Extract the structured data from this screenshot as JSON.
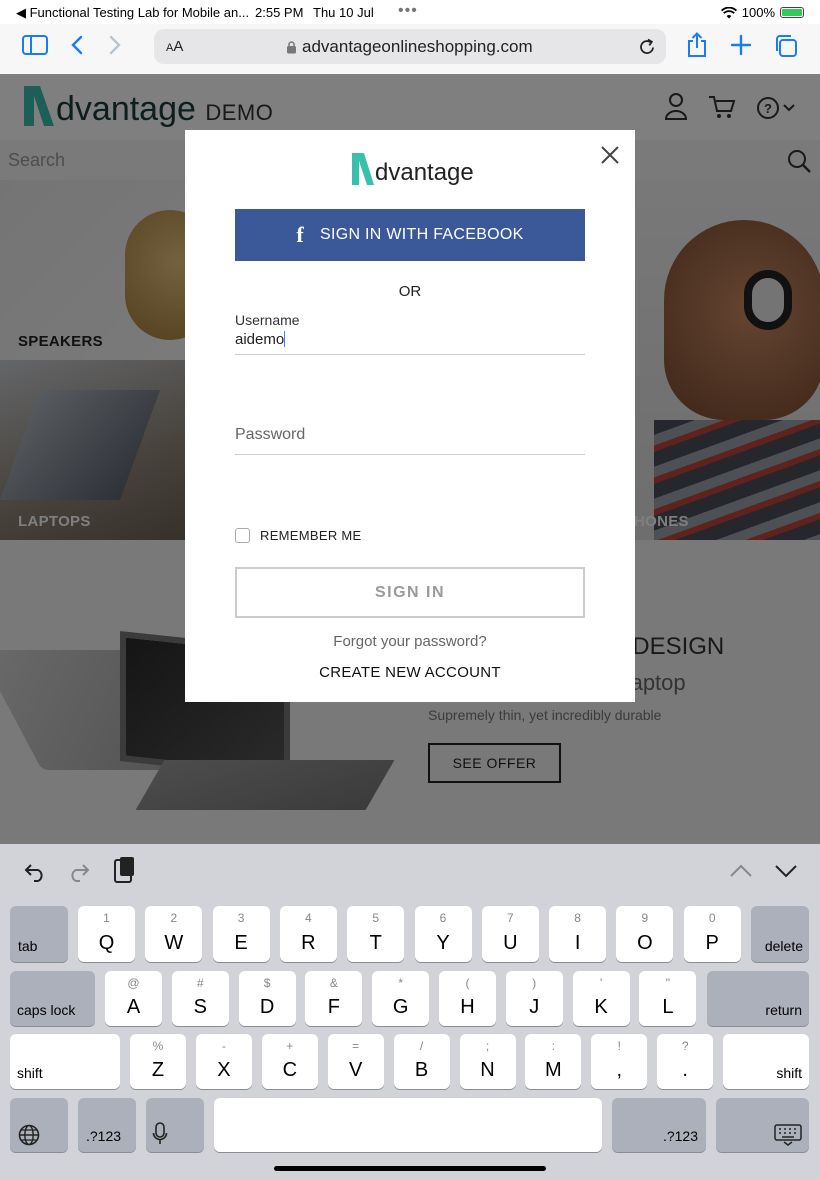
{
  "status_bar": {
    "back_app": "◀ Functional Testing Lab for Mobile an...",
    "time": "2:55 PM",
    "date": "Thu 10 Jul",
    "dots": "•••",
    "battery": "100%"
  },
  "browser": {
    "aa_small": "A",
    "aa_big": "A",
    "url": "advantageonlineshopping.com"
  },
  "site": {
    "logo": "dvantage",
    "logo_suffix": "DEMO",
    "search_placeholder": "Search",
    "tiles": {
      "speakers": "SPEAKERS",
      "laptops": "LAPTOPS",
      "headphones": "HONES"
    },
    "promo": {
      "title": "Y DESIGN",
      "subtitle": "n Laptop",
      "desc": "Supremely thin, yet incredibly durable",
      "button": "SEE OFFER"
    }
  },
  "modal": {
    "logo": "dvantage",
    "facebook_label": "SIGN IN WITH FACEBOOK",
    "or": "OR",
    "username_label": "Username",
    "username_value": "aidemo",
    "password_placeholder": "Password",
    "remember_label": "REMEMBER ME",
    "signin_label": "SIGN IN",
    "forgot_label": "Forgot your password?",
    "create_label": "CREATE NEW ACCOUNT"
  },
  "keyboard": {
    "row1": [
      {
        "sub": "1",
        "main": "Q"
      },
      {
        "sub": "2",
        "main": "W"
      },
      {
        "sub": "3",
        "main": "E"
      },
      {
        "sub": "4",
        "main": "R"
      },
      {
        "sub": "5",
        "main": "T"
      },
      {
        "sub": "6",
        "main": "Y"
      },
      {
        "sub": "7",
        "main": "U"
      },
      {
        "sub": "8",
        "main": "I"
      },
      {
        "sub": "9",
        "main": "O"
      },
      {
        "sub": "0",
        "main": "P"
      }
    ],
    "row2": [
      {
        "sub": "@",
        "main": "A"
      },
      {
        "sub": "#",
        "main": "S"
      },
      {
        "sub": "$",
        "main": "D"
      },
      {
        "sub": "&",
        "main": "F"
      },
      {
        "sub": "*",
        "main": "G"
      },
      {
        "sub": "(",
        "main": "H"
      },
      {
        "sub": ")",
        "main": "J"
      },
      {
        "sub": "'",
        "main": "K"
      },
      {
        "sub": "\"",
        "main": "L"
      }
    ],
    "row3": [
      {
        "sub": "%",
        "main": "Z"
      },
      {
        "sub": "-",
        "main": "X"
      },
      {
        "sub": "+",
        "main": "C"
      },
      {
        "sub": "=",
        "main": "V"
      },
      {
        "sub": "/",
        "main": "B"
      },
      {
        "sub": ";",
        "main": "N"
      },
      {
        "sub": ":",
        "main": "M"
      },
      {
        "sub": "!",
        "main": ","
      },
      {
        "sub": "?",
        "main": "."
      }
    ],
    "tab": "tab",
    "delete": "delete",
    "caps_lock": "caps lock",
    "return": "return",
    "shift": "shift",
    "numbers": ".?123"
  }
}
